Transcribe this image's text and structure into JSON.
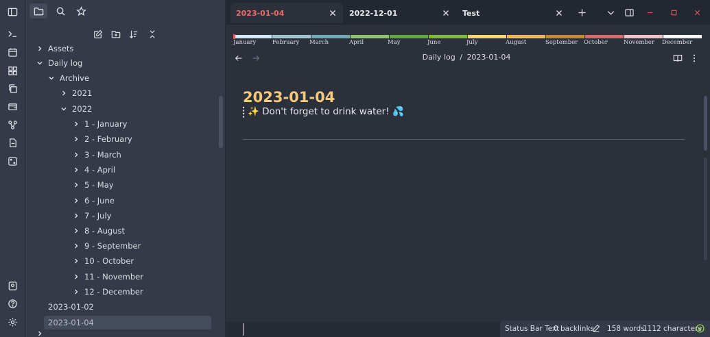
{
  "sidebar": {
    "tree": [
      {
        "label": "Assets",
        "expanded": false
      },
      {
        "label": "Daily log",
        "expanded": true
      },
      {
        "label": "Archive",
        "expanded": true
      },
      {
        "label": "2021",
        "expanded": false
      },
      {
        "label": "2022",
        "expanded": true
      },
      {
        "label": "1 - January"
      },
      {
        "label": "2 - February"
      },
      {
        "label": "3 - March"
      },
      {
        "label": "4 - April"
      },
      {
        "label": "5 - May"
      },
      {
        "label": "6 - June"
      },
      {
        "label": "7 - July"
      },
      {
        "label": "8 - August"
      },
      {
        "label": "9 - September"
      },
      {
        "label": "10 - October"
      },
      {
        "label": "11 - November"
      },
      {
        "label": "12 - December"
      },
      {
        "label": "2023-01-02"
      },
      {
        "label": "2023-01-04",
        "selected": true
      }
    ]
  },
  "tabs": [
    {
      "label": "2023-01-04",
      "active": true
    },
    {
      "label": "2022-12-01"
    },
    {
      "label": "Test"
    }
  ],
  "months": {
    "labels": [
      "January",
      "February",
      "March",
      "April",
      "May",
      "June",
      "July",
      "August",
      "September",
      "October",
      "November",
      "December"
    ],
    "colors": [
      "#cfe6f5",
      "#9dc7d4",
      "#6ea9b8",
      "#8fc56a",
      "#5fa83a",
      "#7fbf1f",
      "#f4d76b",
      "#f0bd3a",
      "#c88d16",
      "#d96a6a",
      "#f2c2c8",
      "#f4f4f4"
    ]
  },
  "breadcrumb": {
    "folder": "Daily log",
    "separator": "/",
    "note": "2023-01-04"
  },
  "note": {
    "title": "2023-01-04",
    "body": "✨ Don't forget to drink water! 💦"
  },
  "status": {
    "custom": "Status Bar Text",
    "backlinks": "0 backlinks",
    "words": "158 words",
    "characters": "1112 characters"
  },
  "colors": {
    "accent": "#f5c97a",
    "active_tab_text": "#e86c6c",
    "window_close": "#e05a5a"
  }
}
